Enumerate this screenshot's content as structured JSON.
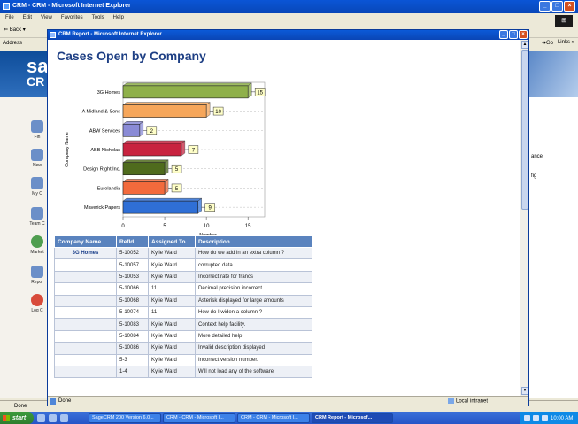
{
  "outer_window": {
    "title": "CRM - CRM - Microsoft Internet Explorer",
    "menu": [
      "File",
      "Edit",
      "View",
      "Favorites",
      "Tools",
      "Help"
    ],
    "back_label": "Back",
    "address_label": "Address",
    "go_label": "Go",
    "links_label": "Links",
    "status_text": "Done",
    "right_texts": [
      "ancel",
      "fig"
    ],
    "sidebar": {
      "logo": "sa",
      "logo2": "CR",
      "items": [
        "Fin",
        "New",
        "My C",
        "Team C",
        "Market",
        "Repor",
        "Log C"
      ]
    }
  },
  "popup": {
    "title": "CRM Report - Microsoft Internet Explorer",
    "status_text": "Done",
    "zone_label": "Local intranet",
    "report_title": "Cases Open by Company"
  },
  "chart_data": {
    "type": "bar",
    "orientation": "horizontal",
    "categories": [
      "3G Homes",
      "A Midland & Sons",
      "ABW Services",
      "ABB Nicholas",
      "Design Right Inc.",
      "Eurolandia",
      "Maverick Papers"
    ],
    "values": [
      15,
      10,
      2,
      7,
      5,
      5,
      9
    ],
    "bar_colors": [
      "#8fb04a",
      "#f6a65a",
      "#8a8bd6",
      "#c8233f",
      "#4f6b1d",
      "#f26a3c",
      "#2f6fd6"
    ],
    "xlabel": "Number",
    "ylabel": "Company Name",
    "xlim": [
      0,
      17
    ],
    "xticks": [
      0,
      5,
      10,
      15
    ],
    "grid": true
  },
  "table": {
    "headers": [
      "Company Name",
      "RefId",
      "Assigned To",
      "Description"
    ],
    "rows": [
      [
        "3G Homes",
        "5-10052",
        "Kylie Ward",
        "How do we add in an extra column ?"
      ],
      [
        "",
        "5-10057",
        "Kylie Ward",
        "corrupted data"
      ],
      [
        "",
        "5-10053",
        "Kylie Ward",
        "Incorrect rate for francs"
      ],
      [
        "",
        "5-10066",
        "11",
        "Decimal precision incorrect"
      ],
      [
        "",
        "5-10068",
        "Kylie Ward",
        "Asterisk displayed for large amounts"
      ],
      [
        "",
        "5-10074",
        "11",
        "How do I widen a column ?"
      ],
      [
        "",
        "5-10083",
        "Kylie Ward",
        "Context help facility."
      ],
      [
        "",
        "5-10084",
        "Kylie Ward",
        "More detailed help"
      ],
      [
        "",
        "5-10086",
        "Kylie Ward",
        "Invalid description displayed"
      ],
      [
        "",
        "5-3",
        "Kylie Ward",
        "Incorrect version number."
      ],
      [
        "",
        "1-4",
        "Kylie Ward",
        "Will not load any of the software"
      ]
    ]
  },
  "taskbar": {
    "start_label": "start",
    "tasks": [
      "SageCRM 200 Version 6.0...",
      "CRM - CRM - Microsoft I...",
      "CRM - CRM - Microsoft I...",
      "CRM Report - Microsof..."
    ],
    "active_task": 3,
    "clock": "10:00 AM"
  }
}
